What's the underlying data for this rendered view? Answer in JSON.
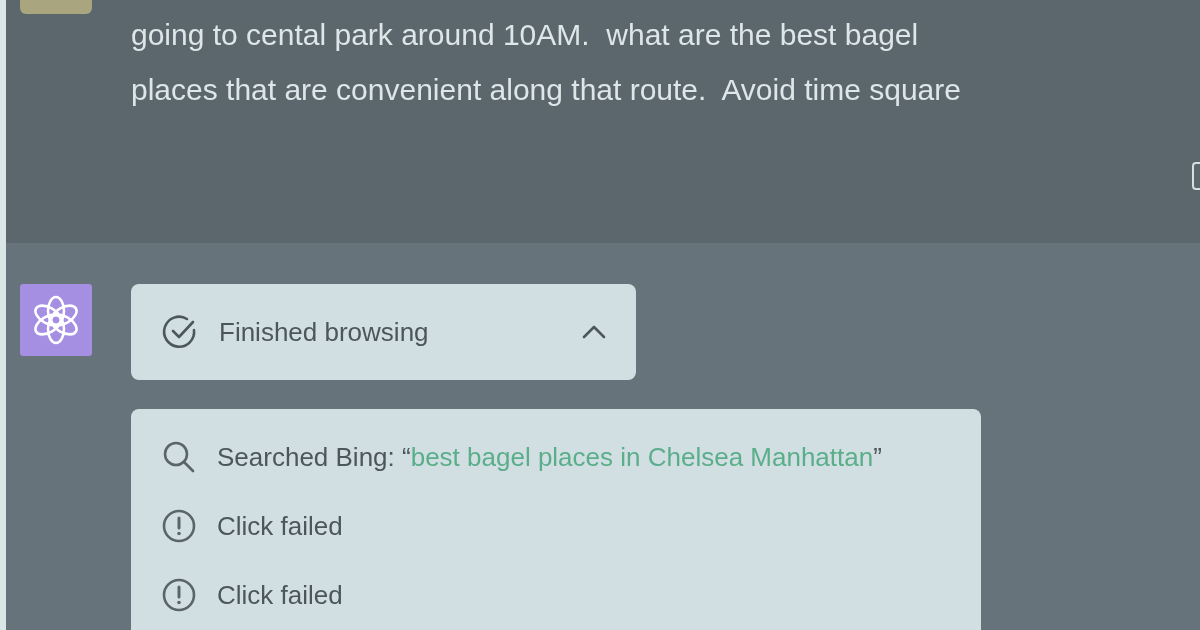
{
  "user_message": {
    "lines": [
      "going to cental park around 10AM.  what are the best bagel",
      "places that are convenient along that route.  Avoid time square"
    ]
  },
  "browsing": {
    "label": "Finished browsing",
    "expanded": true,
    "steps": [
      {
        "kind": "search",
        "prefix": "Searched Bing: “",
        "query": "best bagel places in Chelsea Manhattan",
        "suffix": "”"
      },
      {
        "kind": "error",
        "text": "Click failed"
      },
      {
        "kind": "error",
        "text": "Click failed"
      }
    ]
  }
}
